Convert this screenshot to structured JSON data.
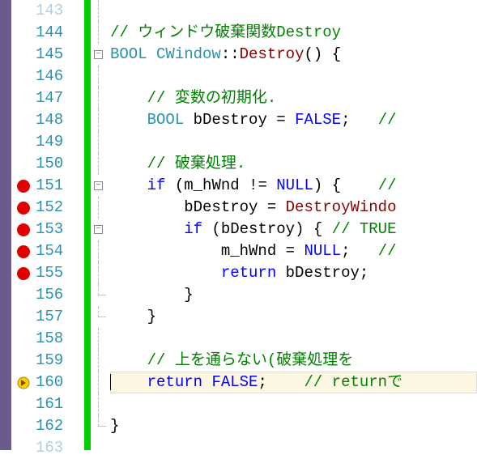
{
  "lines": [
    {
      "num": "143",
      "faded": true,
      "bp": false,
      "arrow": false,
      "fold": "line",
      "current": false,
      "tokens": []
    },
    {
      "num": "144",
      "faded": false,
      "bp": false,
      "arrow": false,
      "fold": "line",
      "current": false,
      "tokens": [
        {
          "cls": "tk-comment",
          "txt": "// ウィンドウ破棄関数Destroy"
        }
      ]
    },
    {
      "num": "145",
      "faded": false,
      "bp": false,
      "arrow": false,
      "fold": "box-minus",
      "current": false,
      "tokens": [
        {
          "cls": "tk-type",
          "txt": "BOOL"
        },
        {
          "cls": "tk-punct",
          "txt": " "
        },
        {
          "cls": "tk-type",
          "txt": "CWindow"
        },
        {
          "cls": "tk-punct",
          "txt": "::"
        },
        {
          "cls": "tk-func",
          "txt": "Destroy"
        },
        {
          "cls": "tk-punct",
          "txt": "() {"
        }
      ]
    },
    {
      "num": "146",
      "faded": false,
      "bp": false,
      "arrow": false,
      "fold": "line",
      "current": false,
      "tokens": []
    },
    {
      "num": "147",
      "faded": false,
      "bp": false,
      "arrow": false,
      "fold": "line",
      "current": false,
      "tokens": [
        {
          "cls": "tk-punct",
          "txt": "    "
        },
        {
          "cls": "tk-comment",
          "txt": "// 変数の初期化."
        }
      ]
    },
    {
      "num": "148",
      "faded": false,
      "bp": false,
      "arrow": false,
      "fold": "line",
      "current": false,
      "tokens": [
        {
          "cls": "tk-punct",
          "txt": "    "
        },
        {
          "cls": "tk-type",
          "txt": "BOOL"
        },
        {
          "cls": "tk-punct",
          "txt": " "
        },
        {
          "cls": "tk-ident",
          "txt": "bDestroy"
        },
        {
          "cls": "tk-punct",
          "txt": " = "
        },
        {
          "cls": "tk-bool",
          "txt": "FALSE"
        },
        {
          "cls": "tk-punct",
          "txt": ";   "
        },
        {
          "cls": "tk-comment",
          "txt": "//"
        }
      ]
    },
    {
      "num": "149",
      "faded": false,
      "bp": false,
      "arrow": false,
      "fold": "line",
      "current": false,
      "tokens": []
    },
    {
      "num": "150",
      "faded": false,
      "bp": false,
      "arrow": false,
      "fold": "line",
      "current": false,
      "tokens": [
        {
          "cls": "tk-punct",
          "txt": "    "
        },
        {
          "cls": "tk-comment",
          "txt": "// 破棄処理."
        }
      ]
    },
    {
      "num": "151",
      "faded": false,
      "bp": true,
      "arrow": false,
      "fold": "box-minus",
      "current": false,
      "tokens": [
        {
          "cls": "tk-punct",
          "txt": "    "
        },
        {
          "cls": "tk-keyword",
          "txt": "if"
        },
        {
          "cls": "tk-punct",
          "txt": " ("
        },
        {
          "cls": "tk-ident",
          "txt": "m_hWnd"
        },
        {
          "cls": "tk-punct",
          "txt": " != "
        },
        {
          "cls": "tk-null",
          "txt": "NULL"
        },
        {
          "cls": "tk-punct",
          "txt": ") {    "
        },
        {
          "cls": "tk-comment",
          "txt": "//"
        }
      ]
    },
    {
      "num": "152",
      "faded": false,
      "bp": true,
      "arrow": false,
      "fold": "line",
      "current": false,
      "tokens": [
        {
          "cls": "tk-punct",
          "txt": "        "
        },
        {
          "cls": "tk-ident",
          "txt": "bDestroy"
        },
        {
          "cls": "tk-punct",
          "txt": " = "
        },
        {
          "cls": "tk-func",
          "txt": "DestroyWindo"
        }
      ]
    },
    {
      "num": "153",
      "faded": false,
      "bp": true,
      "arrow": false,
      "fold": "box-minus",
      "current": false,
      "tokens": [
        {
          "cls": "tk-punct",
          "txt": "        "
        },
        {
          "cls": "tk-keyword",
          "txt": "if"
        },
        {
          "cls": "tk-punct",
          "txt": " ("
        },
        {
          "cls": "tk-ident",
          "txt": "bDestroy"
        },
        {
          "cls": "tk-punct",
          "txt": ") { "
        },
        {
          "cls": "tk-comment",
          "txt": "// TRUE"
        }
      ]
    },
    {
      "num": "154",
      "faded": false,
      "bp": true,
      "arrow": false,
      "fold": "line",
      "current": false,
      "tokens": [
        {
          "cls": "tk-punct",
          "txt": "            "
        },
        {
          "cls": "tk-ident",
          "txt": "m_hWnd"
        },
        {
          "cls": "tk-punct",
          "txt": " = "
        },
        {
          "cls": "tk-null",
          "txt": "NULL"
        },
        {
          "cls": "tk-punct",
          "txt": ";   "
        },
        {
          "cls": "tk-comment",
          "txt": "//"
        }
      ]
    },
    {
      "num": "155",
      "faded": false,
      "bp": true,
      "arrow": false,
      "fold": "line",
      "current": false,
      "tokens": [
        {
          "cls": "tk-punct",
          "txt": "            "
        },
        {
          "cls": "tk-keyword",
          "txt": "return"
        },
        {
          "cls": "tk-punct",
          "txt": " "
        },
        {
          "cls": "tk-ident",
          "txt": "bDestroy"
        },
        {
          "cls": "tk-punct",
          "txt": ";"
        }
      ]
    },
    {
      "num": "156",
      "faded": false,
      "bp": false,
      "arrow": false,
      "fold": "end",
      "current": false,
      "tokens": [
        {
          "cls": "tk-punct",
          "txt": "        }"
        }
      ]
    },
    {
      "num": "157",
      "faded": false,
      "bp": false,
      "arrow": false,
      "fold": "end",
      "current": false,
      "tokens": [
        {
          "cls": "tk-punct",
          "txt": "    }"
        }
      ]
    },
    {
      "num": "158",
      "faded": false,
      "bp": false,
      "arrow": false,
      "fold": "line",
      "current": false,
      "tokens": []
    },
    {
      "num": "159",
      "faded": false,
      "bp": false,
      "arrow": false,
      "fold": "line",
      "current": false,
      "tokens": [
        {
          "cls": "tk-punct",
          "txt": "    "
        },
        {
          "cls": "tk-comment",
          "txt": "// 上を通らない(破棄処理を"
        }
      ]
    },
    {
      "num": "160",
      "faded": false,
      "bp": false,
      "arrow": true,
      "fold": "line",
      "current": true,
      "tokens": [
        {
          "cls": "caret",
          "txt": ""
        },
        {
          "cls": "tk-punct",
          "txt": "    "
        },
        {
          "cls": "tk-keyword",
          "txt": "return"
        },
        {
          "cls": "tk-punct",
          "txt": " "
        },
        {
          "cls": "tk-bool",
          "txt": "FALSE"
        },
        {
          "cls": "tk-punct",
          "txt": ";    "
        },
        {
          "cls": "tk-comment",
          "txt": "// returnで"
        }
      ]
    },
    {
      "num": "161",
      "faded": false,
      "bp": false,
      "arrow": false,
      "fold": "line",
      "current": false,
      "tokens": []
    },
    {
      "num": "162",
      "faded": false,
      "bp": false,
      "arrow": false,
      "fold": "end",
      "current": false,
      "tokens": [
        {
          "cls": "tk-punct",
          "txt": "}"
        }
      ]
    },
    {
      "num": "163",
      "faded": true,
      "bp": false,
      "arrow": false,
      "fold": "",
      "current": false,
      "tokens": []
    }
  ],
  "foldMinus": "−"
}
